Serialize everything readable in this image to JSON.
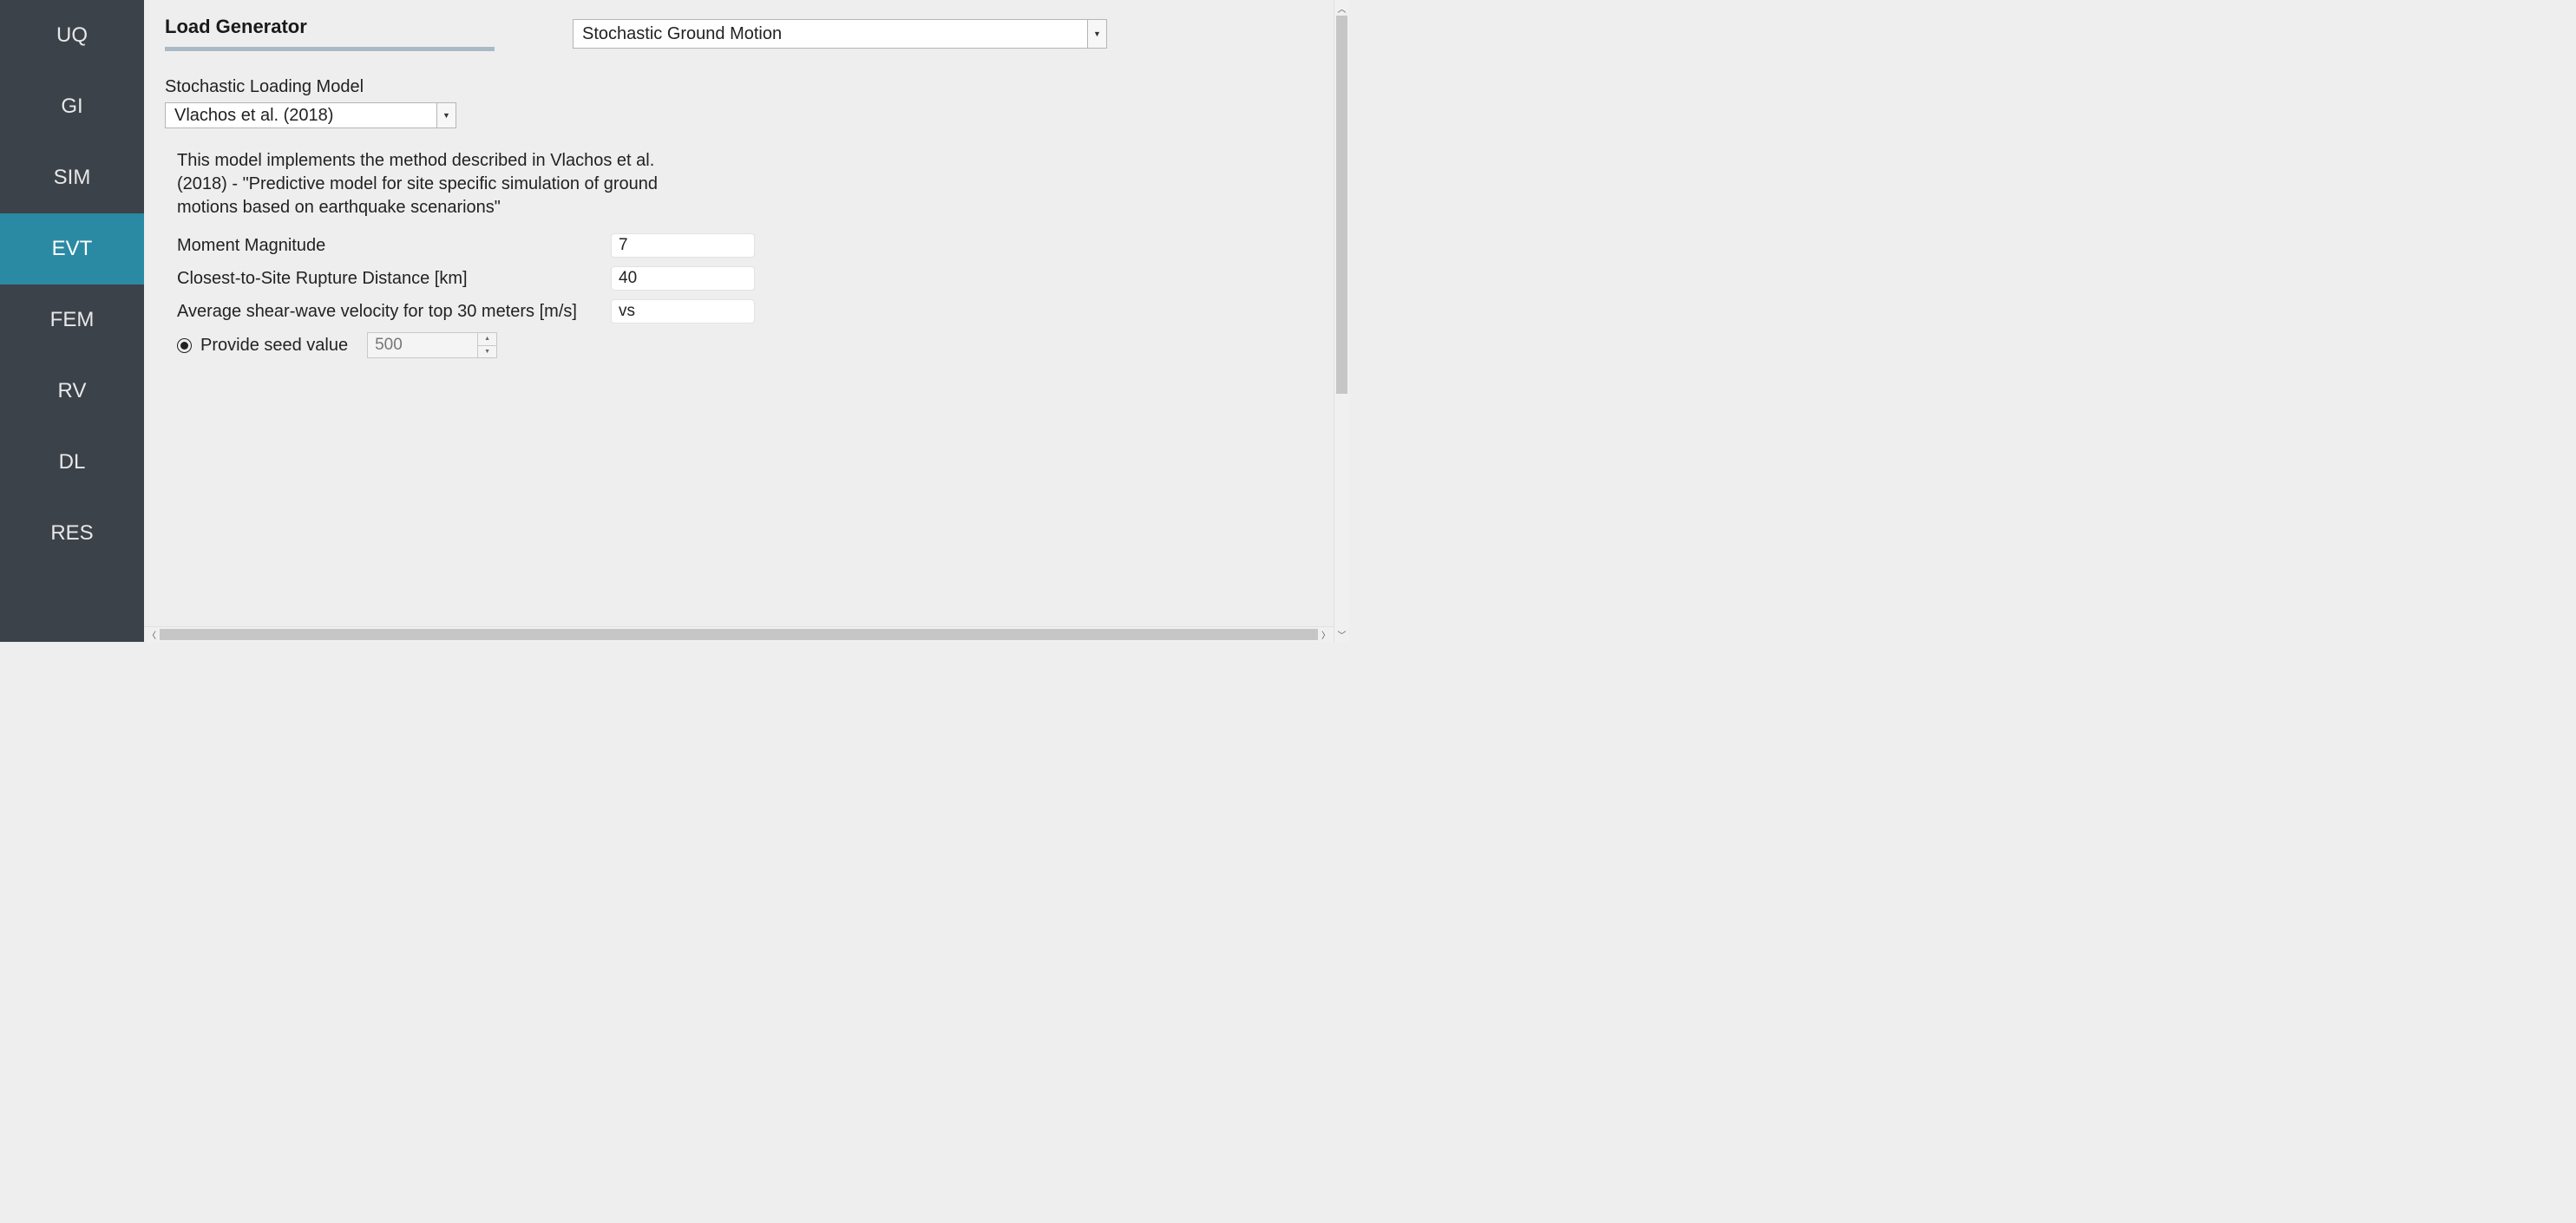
{
  "sidebar": {
    "items": [
      {
        "label": "UQ"
      },
      {
        "label": "GI"
      },
      {
        "label": "SIM"
      },
      {
        "label": "EVT"
      },
      {
        "label": "FEM"
      },
      {
        "label": "RV"
      },
      {
        "label": "DL"
      },
      {
        "label": "RES"
      }
    ],
    "active_index": 3
  },
  "header": {
    "title": "Load Generator",
    "generator_selected": "Stochastic Ground Motion"
  },
  "model": {
    "label": "Stochastic Loading Model",
    "selected": "Vlachos et al. (2018)",
    "description": "This model implements the method described in Vlachos et al. (2018) - \"Predictive model for site specific simulation of ground motions based on earthquake scenarions\""
  },
  "fields": {
    "moment_magnitude": {
      "label": "Moment Magnitude",
      "value": "7"
    },
    "rupture_distance": {
      "label": "Closest-to-Site Rupture Distance [km]",
      "value": "40"
    },
    "shear_velocity": {
      "label": "Average shear-wave velocity for top 30 meters [m/s]",
      "value": "vs"
    }
  },
  "seed": {
    "label": "Provide seed value",
    "value": "500",
    "selected": true
  }
}
